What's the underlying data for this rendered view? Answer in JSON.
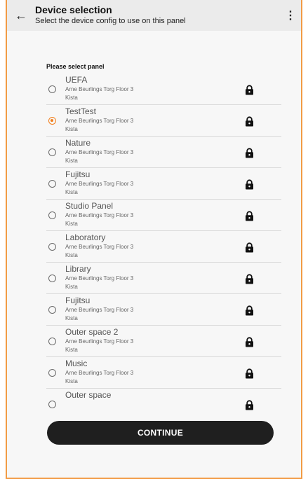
{
  "header": {
    "title": "Device selection",
    "subtitle": "Select the device config to use on this panel",
    "back_icon": "arrow-left-icon",
    "more_icon": "more-vertical-icon"
  },
  "list": {
    "label": "Please select panel",
    "items": [
      {
        "name": "UEFA",
        "address": "Arne Beurlings Torg  Floor 3",
        "city": "Kista",
        "selected": false
      },
      {
        "name": "TestTest",
        "address": "Arne Beurlings Torg  Floor 3",
        "city": "Kista",
        "selected": true
      },
      {
        "name": "Nature",
        "address": "Arne Beurlings Torg  Floor 3",
        "city": "Kista",
        "selected": false
      },
      {
        "name": "Fujitsu",
        "address": "Arne Beurlings Torg  Floor 3",
        "city": "Kista",
        "selected": false
      },
      {
        "name": "Studio Panel",
        "address": "Arne Beurlings Torg  Floor 3",
        "city": "Kista",
        "selected": false
      },
      {
        "name": "Laboratory",
        "address": "Arne Beurlings Torg  Floor 3",
        "city": "Kista",
        "selected": false
      },
      {
        "name": "Library",
        "address": "Arne Beurlings Torg  Floor 3",
        "city": "Kista",
        "selected": false
      },
      {
        "name": "Fujitsu",
        "address": "Arne Beurlings Torg  Floor 3",
        "city": "Kista",
        "selected": false
      },
      {
        "name": "Outer space 2",
        "address": "Arne Beurlings Torg  Floor 3",
        "city": "Kista",
        "selected": false
      },
      {
        "name": "Music",
        "address": "Arne Beurlings Torg  Floor 3",
        "city": "Kista",
        "selected": false
      },
      {
        "name": "Outer space",
        "address": "",
        "city": "",
        "selected": false
      }
    ]
  },
  "continue_label": "CONTINUE",
  "colors": {
    "accent": "#f2801f",
    "frame": "#f29b45",
    "button": "#1f1f1f"
  }
}
